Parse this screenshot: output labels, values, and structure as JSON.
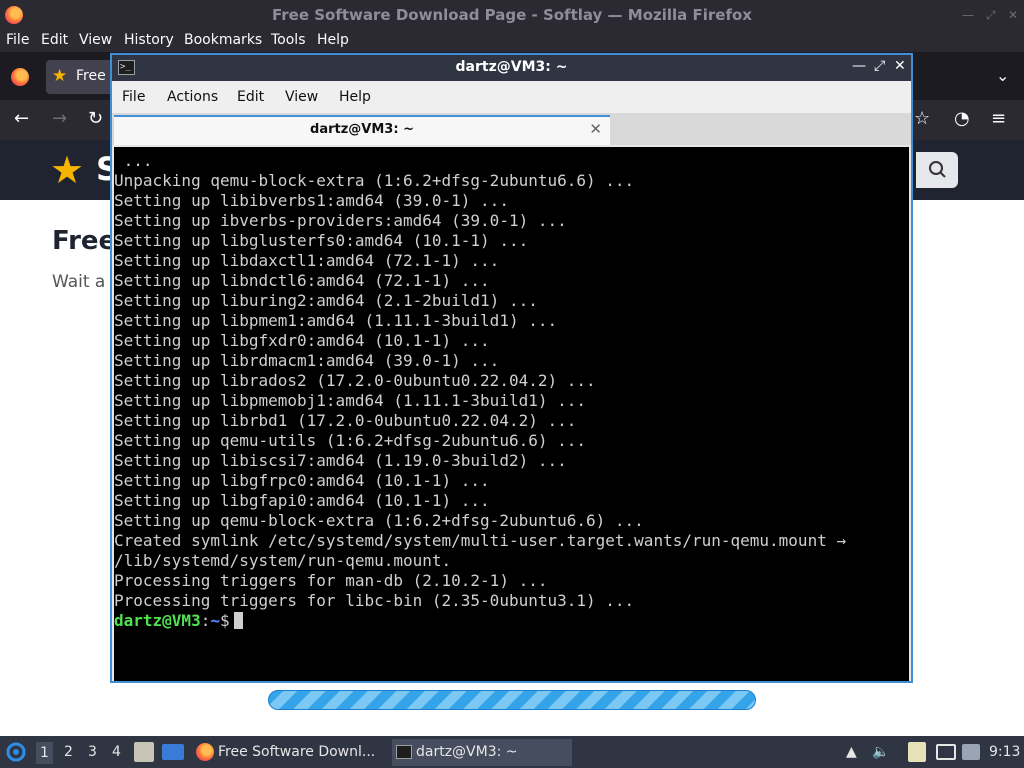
{
  "firefox": {
    "window_title": "Free Software Download Page - Softlay — Mozilla Firefox",
    "menu": [
      "File",
      "Edit",
      "View",
      "History",
      "Bookmarks",
      "Tools",
      "Help"
    ],
    "tab_label": "Free",
    "page": {
      "brand": "S",
      "heading": "Free",
      "wait_text": "Wait a r"
    }
  },
  "terminal": {
    "window_title": "dartz@VM3: ~",
    "menu": [
      "File",
      "Actions",
      "Edit",
      "View",
      "Help"
    ],
    "tab_label": "dartz@VM3: ~",
    "lines": [
      " ...",
      "Unpacking qemu-block-extra (1:6.2+dfsg-2ubuntu6.6) ...",
      "Setting up libibverbs1:amd64 (39.0-1) ...",
      "Setting up ibverbs-providers:amd64 (39.0-1) ...",
      "Setting up libglusterfs0:amd64 (10.1-1) ...",
      "Setting up libdaxctl1:amd64 (72.1-1) ...",
      "Setting up libndctl6:amd64 (72.1-1) ...",
      "Setting up liburing2:amd64 (2.1-2build1) ...",
      "Setting up libpmem1:amd64 (1.11.1-3build1) ...",
      "Setting up libgfxdr0:amd64 (10.1-1) ...",
      "Setting up librdmacm1:amd64 (39.0-1) ...",
      "Setting up librados2 (17.2.0-0ubuntu0.22.04.2) ...",
      "Setting up libpmemobj1:amd64 (1.11.1-3build1) ...",
      "Setting up librbd1 (17.2.0-0ubuntu0.22.04.2) ...",
      "Setting up qemu-utils (1:6.2+dfsg-2ubuntu6.6) ...",
      "Setting up libiscsi7:amd64 (1.19.0-3build2) ...",
      "Setting up libgfrpc0:amd64 (10.1-1) ...",
      "Setting up libgfapi0:amd64 (10.1-1) ...",
      "Setting up qemu-block-extra (1:6.2+dfsg-2ubuntu6.6) ...",
      "Created symlink /etc/systemd/system/multi-user.target.wants/run-qemu.mount →",
      "/lib/systemd/system/run-qemu.mount.",
      "Processing triggers for man-db (2.10.2-1) ...",
      "Processing triggers for libc-bin (2.35-0ubuntu3.1) ..."
    ],
    "prompt": {
      "user_host": "dartz@VM3",
      "colon": ":",
      "path": "~",
      "symbol": "$"
    }
  },
  "taskbar": {
    "workspaces": [
      "1",
      "2",
      "3",
      "4"
    ],
    "active_workspace": "1",
    "tasks": [
      {
        "label": "Free Software Downl..."
      },
      {
        "label": "dartz@VM3: ~"
      }
    ],
    "clock": "9:13"
  },
  "colors": {
    "terminal_bg": "#000000",
    "prompt_user": "#4fe24f",
    "prompt_path": "#5b8cff",
    "accent": "#3f8fd6"
  }
}
